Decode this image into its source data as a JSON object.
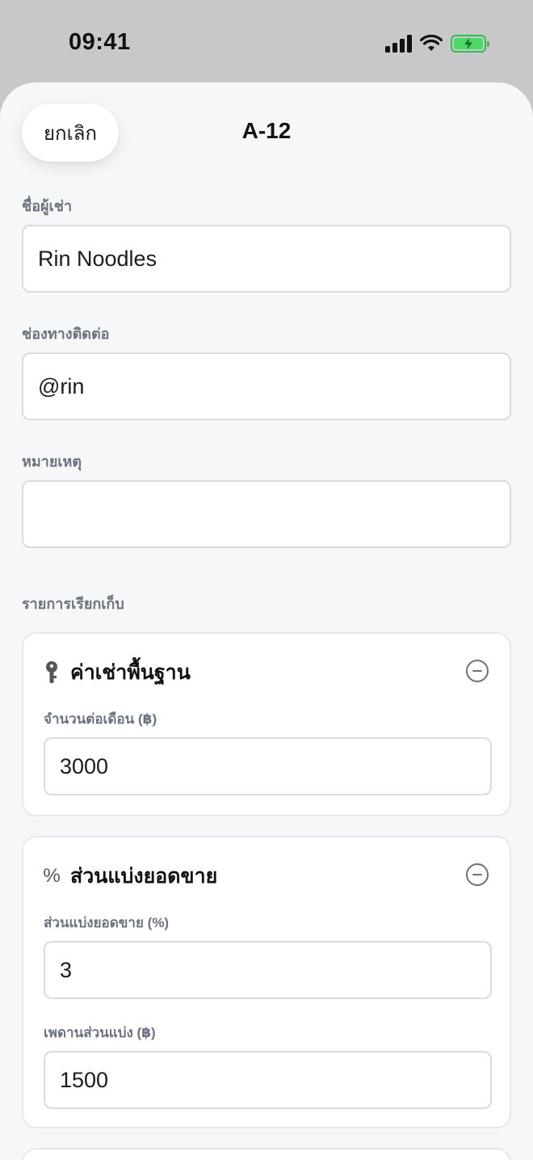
{
  "status_bar": {
    "time": "09:41"
  },
  "nav": {
    "cancel_label": "ยกเลิก",
    "title": "A-12"
  },
  "form": {
    "tenant_name": {
      "label": "ชื่อผู้เช่า",
      "value": "Rin Noodles"
    },
    "contact": {
      "label": "ช่องทางติดต่อ",
      "value": "@rin"
    },
    "note": {
      "label": "หมายเหตุ",
      "value": ""
    }
  },
  "charges": {
    "section_label": "รายการเรียกเก็บ",
    "items": [
      {
        "icon": "key-icon",
        "title": "ค่าเช่าพื้นฐาน",
        "fields": [
          {
            "label": "จำนวนต่อเดือน (฿)",
            "value": "3000"
          }
        ]
      },
      {
        "icon": "percent-icon",
        "icon_glyph": "%",
        "title": "ส่วนแบ่งยอดขาย",
        "fields": [
          {
            "label": "ส่วนแบ่งยอดขาย (%)",
            "value": "3"
          },
          {
            "label": "เพดานส่วนแบ่ง (฿)",
            "value": "1500"
          }
        ]
      }
    ]
  },
  "colors": {
    "sheet_background": "#f6f7f9",
    "label_gray": "#6b7280",
    "battery_green": "#4cd964"
  }
}
